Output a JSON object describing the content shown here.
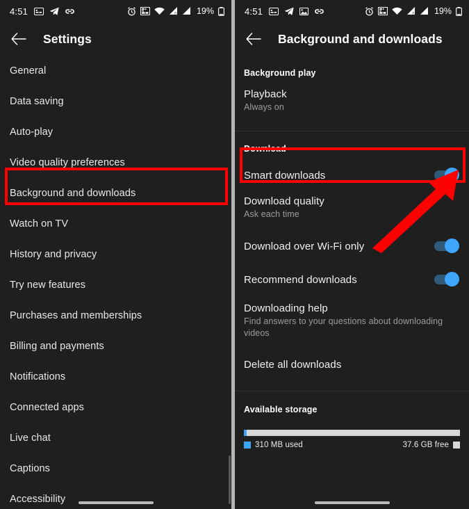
{
  "status_bar": {
    "time": "4:51",
    "battery_percent": "19%",
    "left_icons": [
      "subtitle-card-icon",
      "telegram-plane-icon",
      "link-icon"
    ],
    "left_icons_right_panel": [
      "subtitle-card-icon",
      "telegram-plane-icon",
      "image-icon",
      "link-icon"
    ],
    "right_icons": [
      "alarm-clock-icon",
      "sim-card-icon",
      "wifi-icon",
      "signal-bars-icon",
      "signal-bars-icon",
      "battery-icon"
    ]
  },
  "left_panel": {
    "title": "Settings",
    "back_icon": "back-arrow-icon",
    "highlighted_item": "Background and downloads",
    "items": [
      {
        "label": "General"
      },
      {
        "label": "Data saving"
      },
      {
        "label": "Auto-play"
      },
      {
        "label": "Video quality preferences"
      },
      {
        "label": "Background and downloads"
      },
      {
        "label": "Watch on TV"
      },
      {
        "label": "History and privacy"
      },
      {
        "label": "Try new features"
      },
      {
        "label": "Purchases and memberships"
      },
      {
        "label": "Billing and payments"
      },
      {
        "label": "Notifications"
      },
      {
        "label": "Connected apps"
      },
      {
        "label": "Live chat"
      },
      {
        "label": "Captions"
      },
      {
        "label": "Accessibility"
      }
    ]
  },
  "right_panel": {
    "title": "Background and downloads",
    "back_icon": "back-arrow-icon",
    "sections": [
      {
        "header": "Background play",
        "rows": [
          {
            "title": "Playback",
            "subtitle": "Always on",
            "control": "none"
          }
        ]
      },
      {
        "header": "Download",
        "rows": [
          {
            "title": "Smart downloads",
            "subtitle": "",
            "control": "toggle",
            "toggle_on": true,
            "highlighted": true
          },
          {
            "title": "Download quality",
            "subtitle": "Ask each time",
            "control": "none"
          },
          {
            "title": "Download over Wi-Fi only",
            "subtitle": "",
            "control": "toggle",
            "toggle_on": true
          },
          {
            "title": "Recommend downloads",
            "subtitle": "",
            "control": "toggle",
            "toggle_on": true
          },
          {
            "title": "Downloading help",
            "subtitle": "Find answers to your questions about downloading videos",
            "control": "none"
          },
          {
            "title": "Delete all downloads",
            "subtitle": "",
            "control": "none"
          }
        ]
      },
      {
        "header": "Available storage",
        "rows": []
      }
    ],
    "storage": {
      "used_label": "310 MB used",
      "free_label": "37.6 GB free",
      "used_percent": 1.2
    }
  },
  "annotations": {
    "highlight_color": "#ff0000",
    "arrow_target": "smart-downloads-toggle"
  },
  "colors": {
    "background": "#1f1f1f",
    "accent_blue": "#3ea6ff",
    "toggle_track": "#2f5a7a",
    "text_primary": "#f1f1f1",
    "text_secondary": "#9d9d9d",
    "storage_free": "#d8d8d8"
  }
}
